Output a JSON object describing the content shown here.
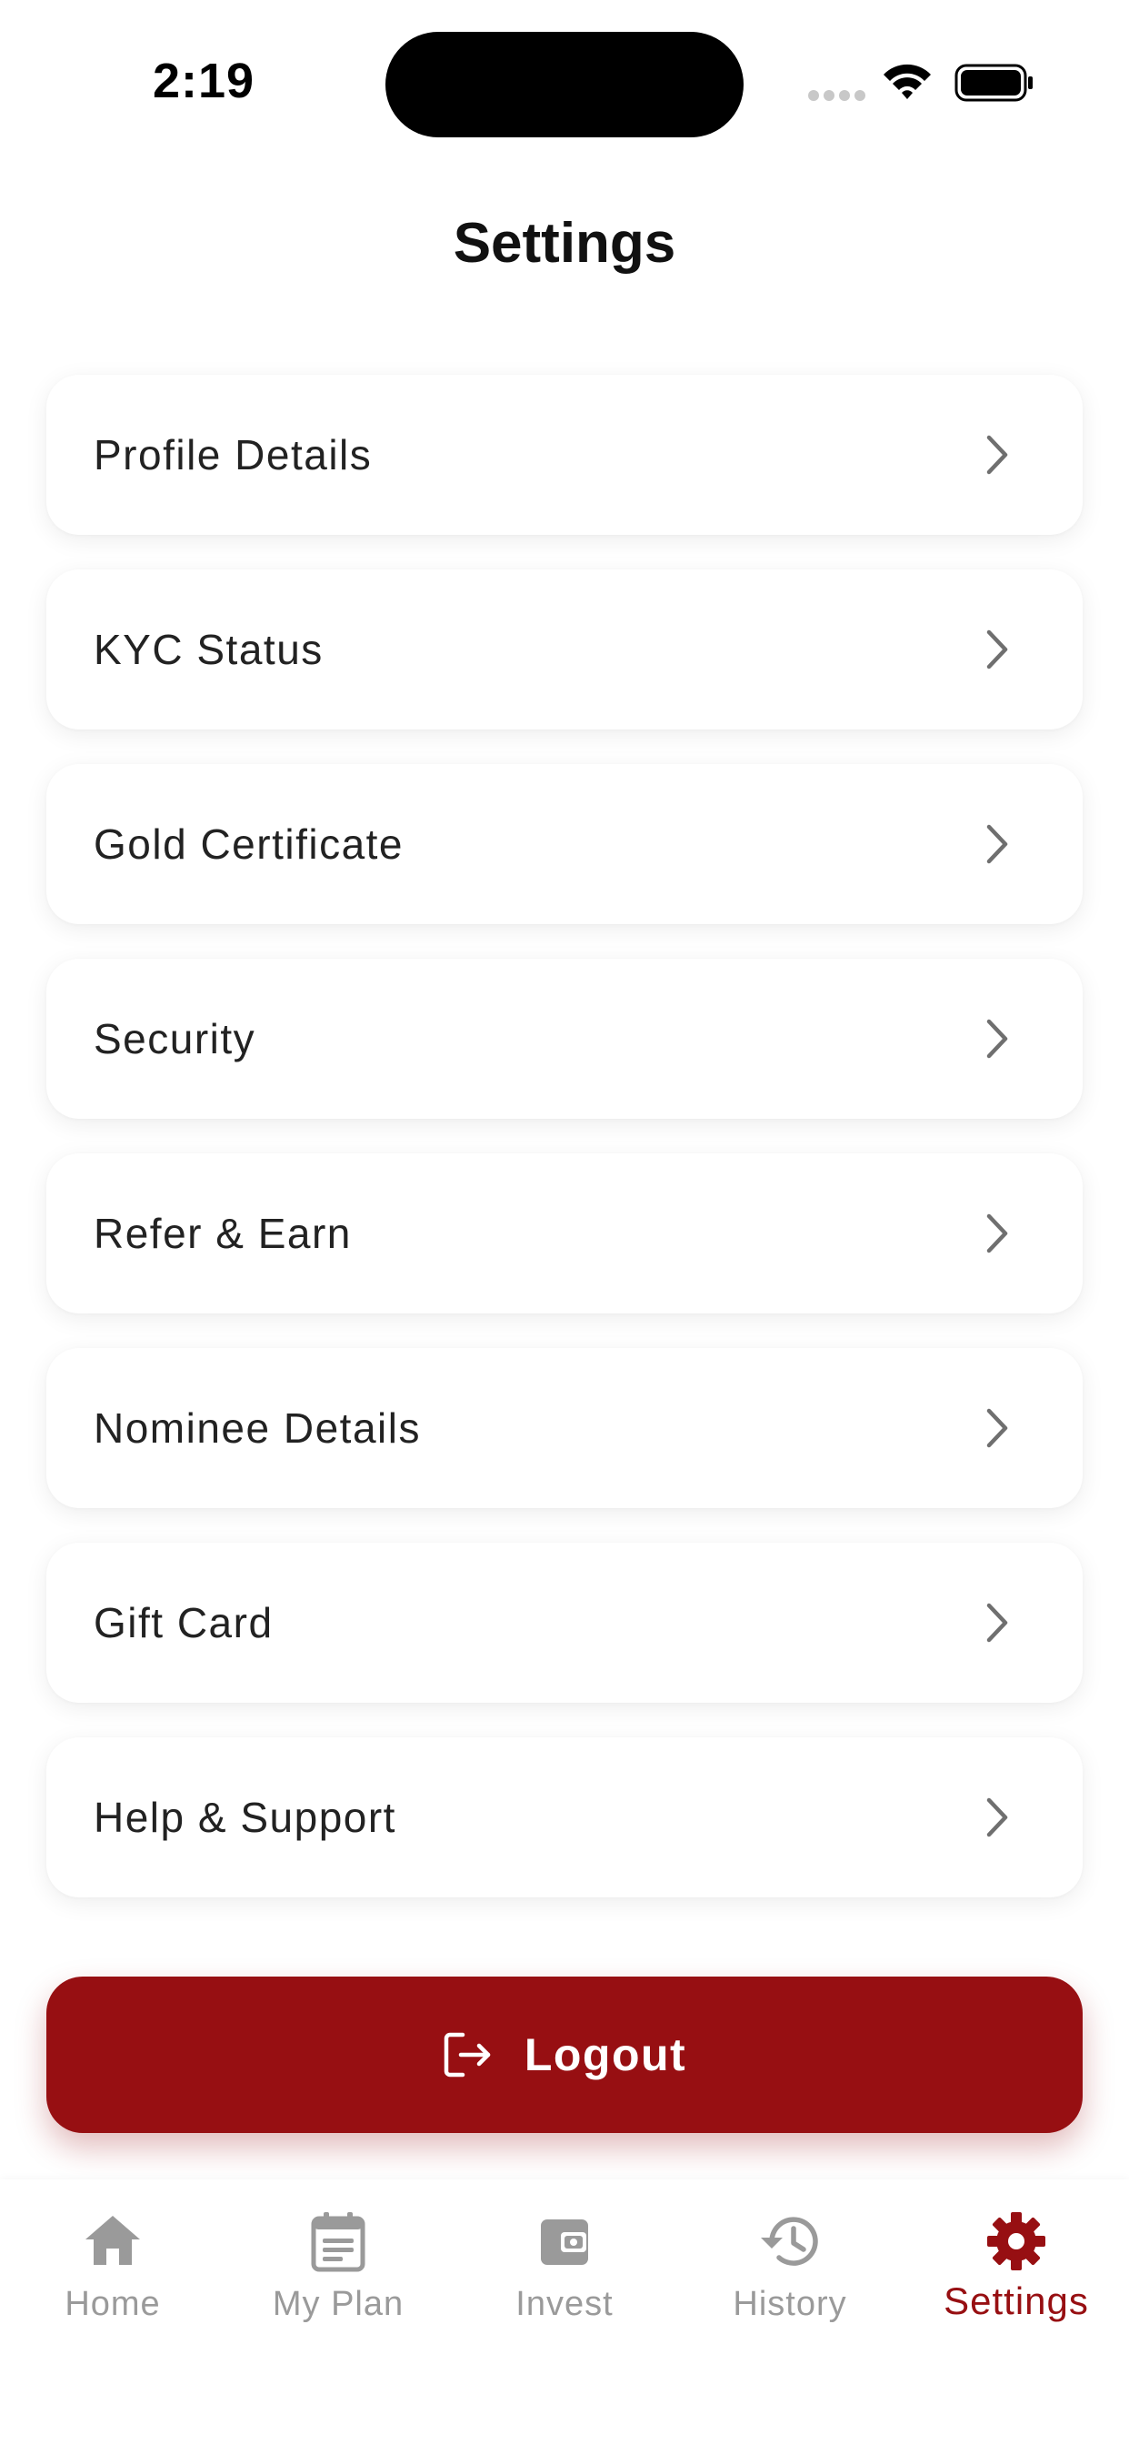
{
  "status_bar": {
    "time": "2:19"
  },
  "header": {
    "title": "Settings"
  },
  "menu": {
    "items": [
      {
        "label": "Profile Details",
        "icon": "chevron-right-icon"
      },
      {
        "label": "KYC Status",
        "icon": "chevron-right-icon"
      },
      {
        "label": "Gold Certificate",
        "icon": "chevron-right-icon"
      },
      {
        "label": "Security",
        "icon": "chevron-right-icon"
      },
      {
        "label": "Refer & Earn",
        "icon": "chevron-right-icon"
      },
      {
        "label": "Nominee Details",
        "icon": "chevron-right-icon"
      },
      {
        "label": "Gift Card",
        "icon": "chevron-right-icon"
      },
      {
        "label": "Help & Support",
        "icon": "chevron-right-icon"
      }
    ]
  },
  "logout": {
    "label": "Logout",
    "icon": "logout-icon"
  },
  "tabs": [
    {
      "label": "Home",
      "icon": "home-icon",
      "active": false
    },
    {
      "label": "My Plan",
      "icon": "calendar-icon",
      "active": false
    },
    {
      "label": "Invest",
      "icon": "wallet-icon",
      "active": false
    },
    {
      "label": "History",
      "icon": "history-icon",
      "active": false
    },
    {
      "label": "Settings",
      "icon": "gear-icon",
      "active": true
    }
  ],
  "colors": {
    "accent": "#970F12",
    "inactive": "#9a9a9a",
    "text": "#222222",
    "background": "#ffffff"
  }
}
